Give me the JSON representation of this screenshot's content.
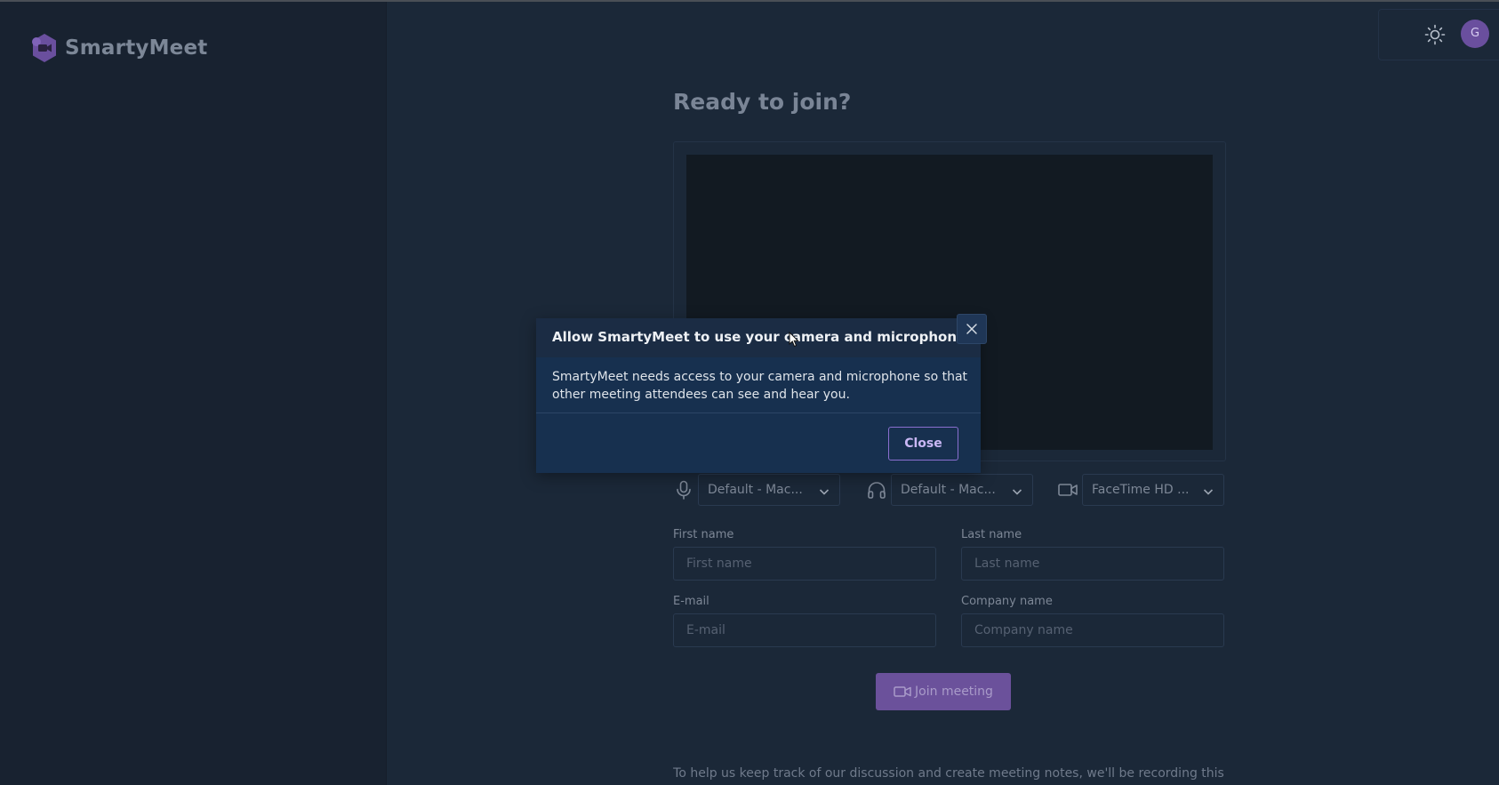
{
  "app": {
    "name": "SmartyMeet",
    "avatar_initial": "G"
  },
  "main": {
    "title": "Ready to join?"
  },
  "devices": {
    "microphone": "Default - Mac...",
    "speaker": "Default - Mac...",
    "camera": "FaceTime HD ..."
  },
  "form": {
    "first_name": {
      "label": "First name",
      "placeholder": "First name"
    },
    "last_name": {
      "label": "Last name",
      "placeholder": "Last name"
    },
    "email": {
      "label": "E-mail",
      "placeholder": "E-mail"
    },
    "company": {
      "label": "Company name",
      "placeholder": "Company name"
    }
  },
  "join_label": "Join meeting",
  "footer_text": "To help us keep track of our discussion and create meeting notes, we'll be recording this",
  "dialog": {
    "title": "Allow SmartyMeet to use your camera and microphone",
    "body": "SmartyMeet needs access to your camera and microphone so that other meeting attendees can see and hear you.",
    "close_label": "Close"
  },
  "icons": {
    "logo": "smartymeet-logo-icon",
    "theme": "sun-icon",
    "mic": "microphone-icon",
    "speaker": "headphones-icon",
    "camera": "video-camera-icon"
  },
  "colors": {
    "accent": "#6b519b",
    "background": "#1b2838",
    "dialog": "#17304f"
  }
}
